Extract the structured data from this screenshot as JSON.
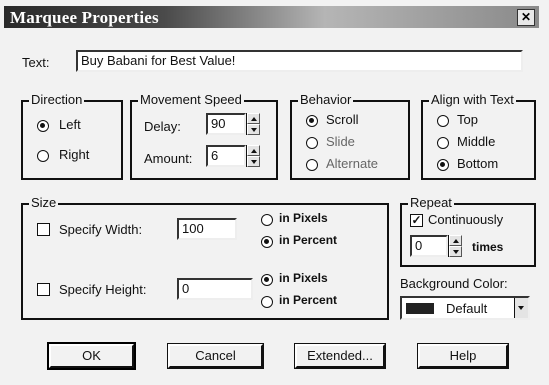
{
  "window": {
    "title": "Marquee Properties"
  },
  "text_field": {
    "label": "Text:",
    "value": "Buy Babani for Best Value!"
  },
  "direction": {
    "title": "Direction",
    "options": [
      "Left",
      "Right"
    ],
    "selected": "Left"
  },
  "movement_speed": {
    "title": "Movement Speed",
    "delay_label": "Delay:",
    "delay_value": "90",
    "amount_label": "Amount:",
    "amount_value": "6"
  },
  "behavior": {
    "title": "Behavior",
    "options": [
      "Scroll",
      "Slide",
      "Alternate"
    ],
    "selected": "Scroll"
  },
  "align": {
    "title": "Align with Text",
    "options": [
      "Top",
      "Middle",
      "Bottom"
    ],
    "selected": "Bottom"
  },
  "size": {
    "title": "Size",
    "width_label": "Specify Width:",
    "width_value": "100",
    "width_checked": false,
    "width_units": [
      "in Pixels",
      "in Percent"
    ],
    "width_selected": "in Percent",
    "height_label": "Specify Height:",
    "height_value": "0",
    "height_checked": false,
    "height_units": [
      "in Pixels",
      "in Percent"
    ],
    "height_selected": "in Pixels"
  },
  "repeat": {
    "title": "Repeat",
    "continuously_label": "Continuously",
    "continuously_checked": true,
    "times_value": "0",
    "times_label": "times"
  },
  "background": {
    "label": "Background Color:",
    "value": "Default",
    "swatch_color": "#222222"
  },
  "buttons": {
    "ok": "OK",
    "cancel": "Cancel",
    "extended": "Extended...",
    "help": "Help"
  }
}
